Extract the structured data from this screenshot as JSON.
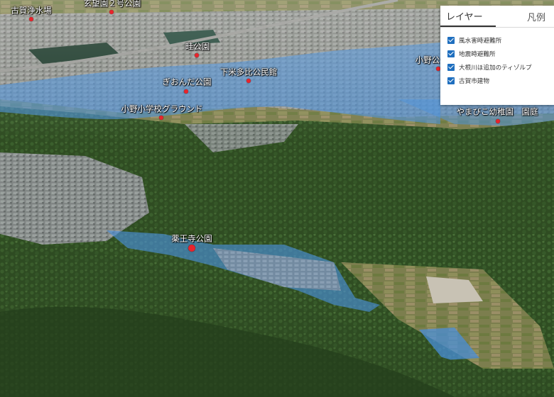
{
  "map": {
    "place_labels": [
      {
        "id": "koga-josuijo",
        "text": "古賀浄水場"
      },
      {
        "id": "nishi2-koen",
        "text": "玄望園２号公園"
      },
      {
        "id": "hokura-koen",
        "text": "畦公園"
      },
      {
        "id": "shimobeta-kominkan",
        "text": "下米多比公民館"
      },
      {
        "id": "gionda-koen",
        "text": "ぎおんだ公園"
      },
      {
        "id": "ono-shogakko-ground",
        "text": "小野小学校グラウンド"
      },
      {
        "id": "ono-koen",
        "text": "小野公"
      },
      {
        "id": "yamabiko-yochien",
        "text": "やまびこ幼稚園　園庭"
      },
      {
        "id": "yakuoji-koen",
        "text": "薬王寺公園"
      }
    ],
    "colors": {
      "flood_overlay": "#4a8fd8",
      "poi_marker": "#e8242c"
    }
  },
  "panel": {
    "tabs": [
      {
        "label": "レイヤー",
        "active": true
      },
      {
        "label": "凡例",
        "active": false
      }
    ],
    "layers": [
      {
        "label": "風水害時避難所",
        "checked": true
      },
      {
        "label": "地震時避難所",
        "checked": true
      },
      {
        "label": "大根川ほ追加のティゾルプ",
        "checked": true
      },
      {
        "label": "古賀市建物",
        "checked": true
      }
    ]
  }
}
